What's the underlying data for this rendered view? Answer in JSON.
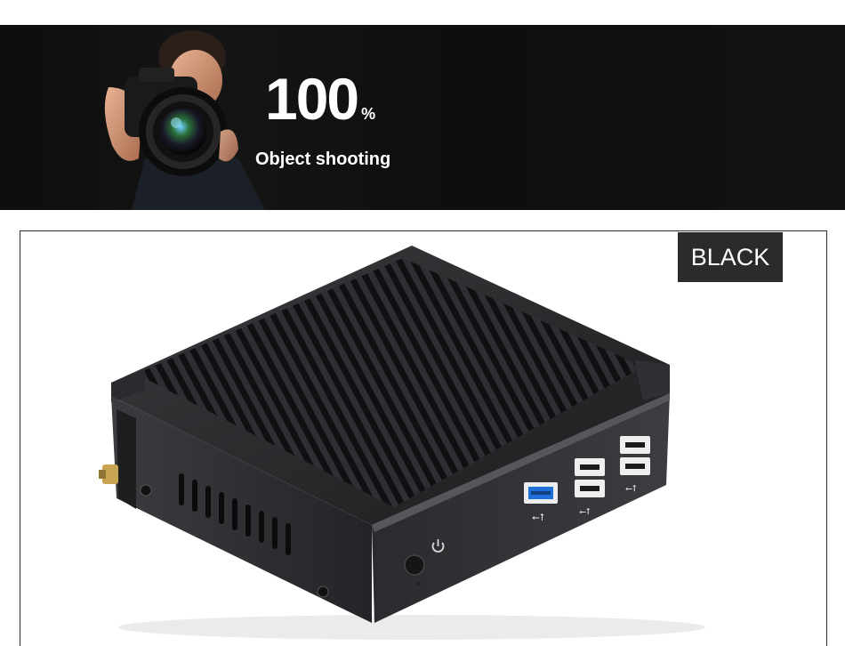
{
  "banner": {
    "headline_number": "100",
    "headline_suffix": "%",
    "caption": "Object shooting",
    "icon": "photographer-with-camera"
  },
  "product": {
    "color_label": "BLACK",
    "icon": "mini-pc-fanless"
  },
  "colors": {
    "banner_bg": "#101010",
    "badge_bg": "#2b2b2b",
    "usb3_blue": "#1e6fd9"
  }
}
